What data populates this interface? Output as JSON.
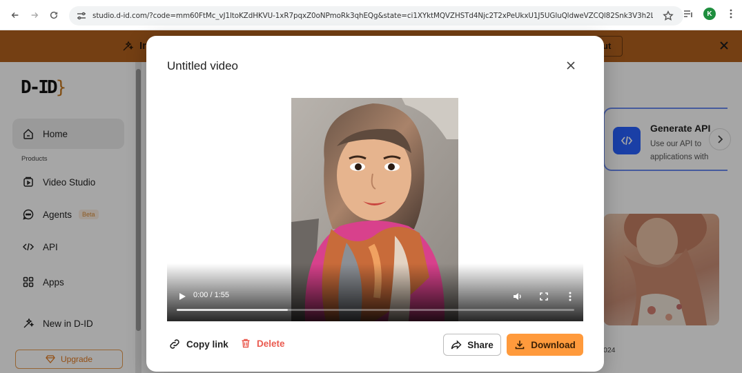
{
  "browser": {
    "url": "studio.d-id.com/?code=mm60FtMc_vJ1ltoKZdHKVU-1xR7pqxZ0oNPmoRk3qhEQg&state=ci1XYktMQVZHSTd4Njc2T2xPeUkxU1J5UGluQldweVZCQl82Snk3V3h2LQ%3D...",
    "profile_initial": "K",
    "profile_color": "#1e8e3e"
  },
  "banner": {
    "text": "Ir",
    "button_label": "ut",
    "color": "#ff8a2a"
  },
  "sidebar": {
    "logo": "D-ID",
    "logo_brace": "}",
    "section_caption": "Products",
    "items": [
      {
        "label": "Home",
        "icon": "home-icon",
        "active": true
      },
      {
        "label": "Video Studio",
        "icon": "video-studio-icon"
      },
      {
        "label": "Agents",
        "icon": "agents-icon",
        "badge": "Beta"
      },
      {
        "label": "API",
        "icon": "code-icon"
      },
      {
        "label": "Apps",
        "icon": "apps-icon"
      },
      {
        "label": "New in D-ID",
        "icon": "sparkle-icon"
      }
    ],
    "upgrade_label": "Upgrade"
  },
  "main": {
    "api_card": {
      "title": "Generate API",
      "description_line1": "Use our API to",
      "description_line2": "applications with"
    },
    "thumbnail_date": "024"
  },
  "modal": {
    "title": "Untitled video",
    "video": {
      "time": "0:00 / 1:55",
      "loaded_fraction": 0.28
    },
    "actions": {
      "copy_link": "Copy link",
      "delete": "Delete",
      "share": "Share",
      "download": "Download"
    },
    "accent_color": "#ff9a3c",
    "delete_color": "#ea5a4f"
  }
}
